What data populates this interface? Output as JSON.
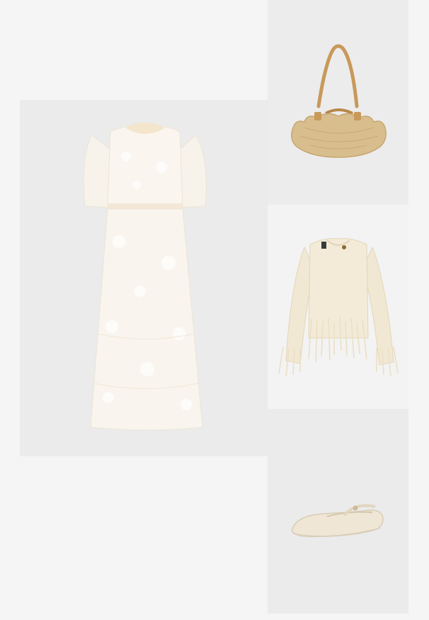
{
  "layout": {
    "name": "outfit-collage",
    "background": "#f5f5f5"
  },
  "items": [
    {
      "id": "dress",
      "icon": "dress-icon",
      "tile_color": "#ebebeb",
      "item_color": "#f8f4ec"
    },
    {
      "id": "bag",
      "icon": "bag-icon",
      "tile_color": "#ececec",
      "item_color": "#d8bd8c"
    },
    {
      "id": "cardigan",
      "icon": "cardigan-icon",
      "tile_color": "#f3f3f3",
      "item_color": "#f1e8d3"
    },
    {
      "id": "shoe",
      "icon": "shoe-icon",
      "tile_color": "#ebebeb",
      "item_color": "#eee4d2"
    }
  ]
}
